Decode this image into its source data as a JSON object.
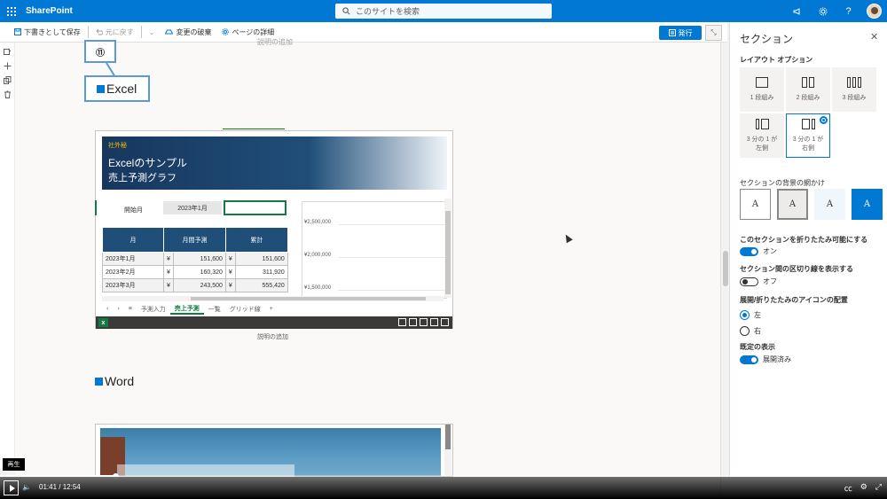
{
  "topbar": {
    "app_name": "SharePoint",
    "search_placeholder": "このサイトを検索",
    "icons": [
      "megaphone-icon",
      "gear-icon",
      "help-icon",
      "avatar"
    ]
  },
  "cmdbar": {
    "save_draft": "下書きとして保存",
    "undo": "元に戻す",
    "discard": "変更の破棄",
    "page_details": "ページの詳細",
    "publish": "発行"
  },
  "canvas": {
    "caption_top": "説明の追加",
    "callout_number": "⑪",
    "excel_heading": "Excel",
    "word_heading": "Word",
    "caption_bottom": "説明の追加"
  },
  "excel": {
    "tag": "社外秘",
    "title_line1": "Excelのサンプル",
    "title_line2": "売上予測グラフ",
    "start_label": "開始月",
    "start_value": "2023年1月",
    "columns": [
      "月",
      "月間予測",
      "累計"
    ],
    "rows": [
      {
        "month": "2023年1月",
        "cur1": "¥",
        "forecast": "151,600",
        "cur2": "¥",
        "total": "151,600"
      },
      {
        "month": "2023年2月",
        "cur1": "¥",
        "forecast": "160,320",
        "cur2": "¥",
        "total": "311,920"
      },
      {
        "month": "2023年3月",
        "cur1": "¥",
        "forecast": "243,500",
        "cur2": "¥",
        "total": "555,420"
      }
    ],
    "chart_axis": [
      "¥2,500,000",
      "¥2,000,000",
      "¥1,500,000"
    ],
    "sheet_tabs": [
      "予測入力",
      "売上予測",
      "一覧",
      "グリッド線"
    ],
    "active_tab": "売上予測"
  },
  "panel": {
    "title": "セクション",
    "layout_title": "レイアウト オプション",
    "layouts": [
      {
        "label": "1 段組み"
      },
      {
        "label": "2 段組み"
      },
      {
        "label": "3 段組み"
      },
      {
        "label": "3 分の 1 が左側"
      },
      {
        "label": "3 分の 1 が右側"
      }
    ],
    "selected_layout": "3 分の 1 が右側",
    "background_title": "セクションの背景の網かけ",
    "background_glyph": "A",
    "collapsible_title": "このセクションを折りたたみ可能にする",
    "collapsible_value": "オン",
    "divider_title": "セクション間の区切り線を表示する",
    "divider_value": "オフ",
    "icon_pos_title": "展開/折りたたみのアイコンの配置",
    "icon_pos_left": "左",
    "icon_pos_right": "右",
    "default_title": "既定の表示",
    "default_value": "展開済み"
  },
  "player": {
    "tooltip": "再生",
    "current_time": "01:41",
    "separator": "/",
    "duration": "12:54",
    "progress_percent": 13
  }
}
